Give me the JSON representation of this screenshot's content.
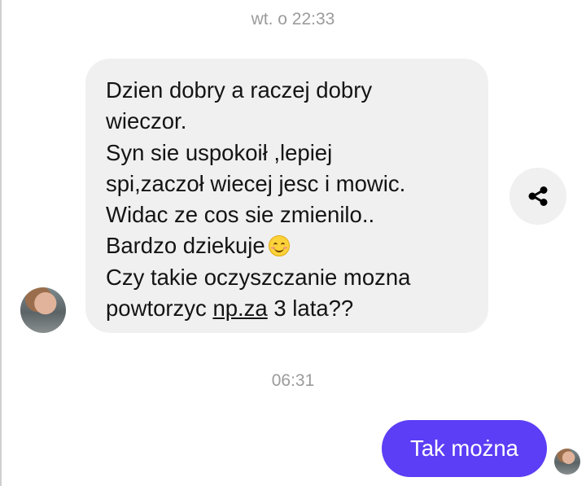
{
  "conversation": {
    "timestamp_1": "wt. o 22:33",
    "incoming_message": {
      "lines": [
        "Dzien dobry a raczej dobry",
        "wieczor.",
        "Syn sie uspokoił ,lepiej",
        "spi,zaczoł wiecej jesc i mowic.",
        "Widac ze cos sie zmienilo..",
        "Bardzo dziekuje",
        "Czy takie oczyszczanie mozna",
        "powtorzyc"
      ],
      "emoji_icon": "smiling-face-icon",
      "link_text": "np.za",
      "line_8_suffix": " 3 lata??"
    },
    "timestamp_2": "06:31",
    "outgoing_message": "Tak można",
    "share_icon": "share-icon"
  },
  "colors": {
    "outgoing_bubble": "#5b3ef5",
    "incoming_bubble": "#f0f0f0",
    "timestamp_text": "#9b9b9b"
  }
}
